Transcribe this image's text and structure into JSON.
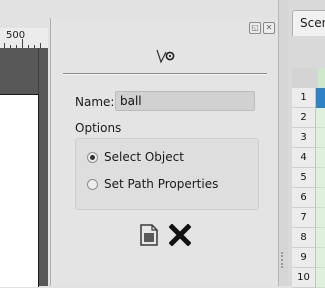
{
  "ruler": {
    "label": "500"
  },
  "object_panel": {
    "name_label": "Name:",
    "name_value": "ball",
    "options_title": "Options",
    "radio_options": [
      {
        "label": "Select Object",
        "selected": true
      },
      {
        "label": "Set Path Properties",
        "selected": false
      }
    ],
    "icons": {
      "tool": "path-tool-icon",
      "document": "document-icon",
      "delete": "delete-x-icon",
      "float": "float-dock-icon",
      "close": "close-dock-icon"
    }
  },
  "scene_panel": {
    "tab_label": "Scen",
    "row_numbers": [
      "1",
      "2",
      "3",
      "4",
      "5",
      "6",
      "7",
      "8",
      "9",
      "10"
    ],
    "selected_row": 1,
    "accent_color": "#2f82c3"
  }
}
